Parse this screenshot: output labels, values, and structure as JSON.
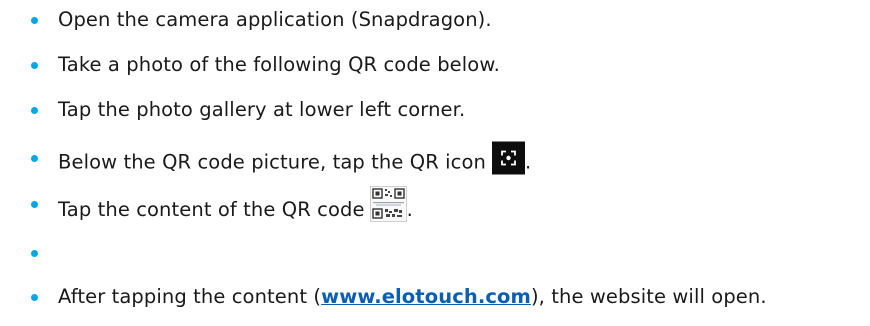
{
  "steps": [
    {
      "text": "Open the camera application (Snapdragon)."
    },
    {
      "text": "Take a photo of the following QR code below."
    },
    {
      "text": "Tap the photo gallery at lower left corner."
    },
    {
      "text_before": "Below the QR code picture, tap the QR icon",
      "text_after": ".",
      "icon": "qr-scan-icon"
    },
    {
      "text_before": "Tap the content of the QR code",
      "text_after": ".",
      "icon": "qr-code-thumbnail"
    },
    {
      "text": ""
    },
    {
      "text_before": "After tapping the content (",
      "link": "www.elotouch.com",
      "text_after": "), the website will open."
    }
  ],
  "colors": {
    "bullet": "#00a6e6",
    "link": "#0b5fb3",
    "text": "#1a1a1a"
  }
}
